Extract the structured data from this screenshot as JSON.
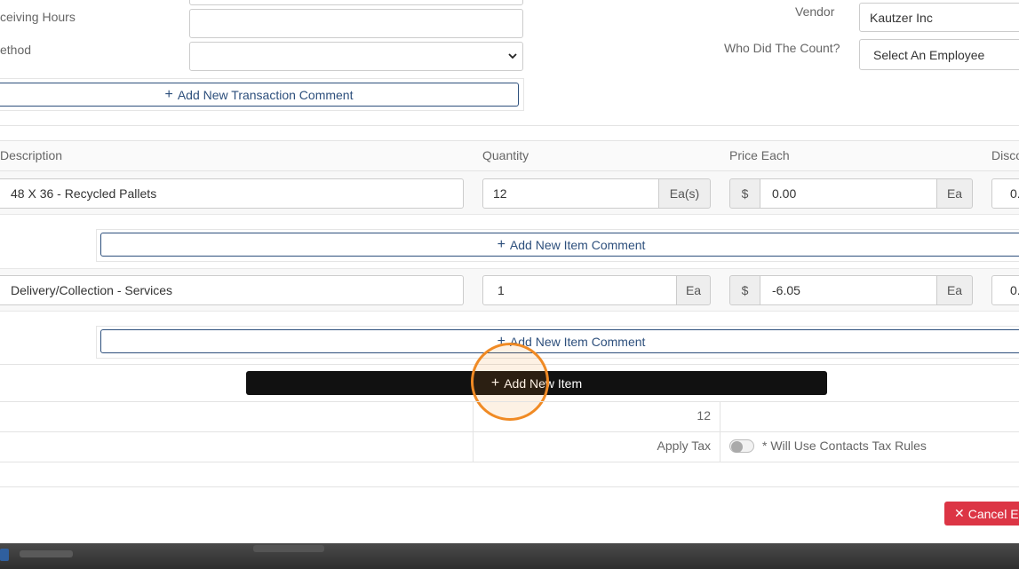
{
  "form": {
    "receiving_hours_label": "ceiving Hours",
    "receiving_hours_value": "",
    "method_label": "ethod",
    "method_value": "",
    "vendor_label": "Vendor",
    "vendor_value": "Kautzer Inc",
    "counter_label": "Who Did The Count?",
    "counter_value": "Select An Employee",
    "add_transaction_comment": "Add New Transaction Comment"
  },
  "table": {
    "headers": [
      "Description",
      "Quantity",
      "Price Each",
      "Disco"
    ],
    "rows": [
      {
        "description": "48 X 36 - Recycled Pallets",
        "quantity": "12",
        "unit": "Ea(s)",
        "currency": "$",
        "price": "0.00",
        "price_unit": "Ea",
        "discount": "0."
      },
      {
        "description": "Delivery/Collection - Services",
        "quantity": "1",
        "unit": "Ea",
        "currency": "$",
        "price": "-6.05",
        "price_unit": "Ea",
        "discount": "0."
      }
    ],
    "add_item_comment": "Add New Item Comment",
    "add_item": "Add New Item",
    "total_quantity": "12",
    "apply_tax_label": "Apply Tax",
    "tax_note": "* Will Use Contacts Tax Rules"
  },
  "footer": {
    "cancel_label": "Cancel Ed"
  },
  "colors": {
    "primary": "#2d4f7c",
    "dark_button": "#111111",
    "danger": "#dc3545",
    "highlight": "#f08a24"
  }
}
